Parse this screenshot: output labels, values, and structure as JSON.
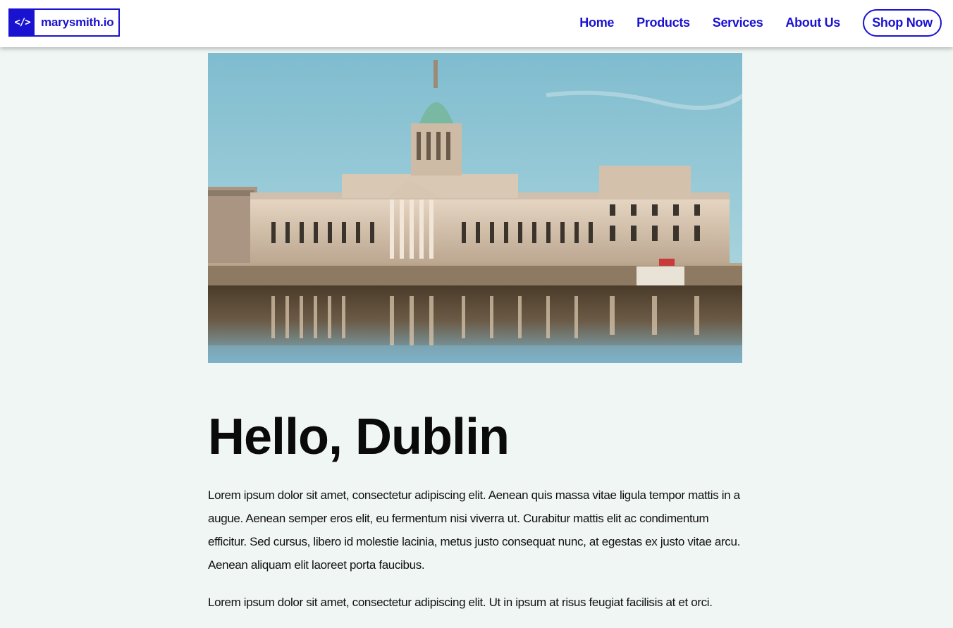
{
  "header": {
    "logo_mark": "</>",
    "logo_text": "marysmith.io",
    "nav": [
      "Home",
      "Products",
      "Services",
      "About Us"
    ],
    "cta_label": "Shop Now"
  },
  "colors": {
    "accent": "#1a12d1",
    "page_background": "#eff6f3",
    "header_background": "#ffffff",
    "heading_text": "#0a0a0a"
  },
  "hero": {
    "image_name": "dublin-custom-house-photo",
    "icon": "photo-icon"
  },
  "article": {
    "title": "Hello, Dublin",
    "paragraphs": [
      "Lorem ipsum dolor sit amet, consectetur adipiscing elit. Aenean quis massa vitae ligula tempor mattis in a augue. Aenean semper eros elit, eu fermentum nisi viverra ut. Curabitur mattis elit ac condimentum efficitur. Sed cursus, libero id molestie lacinia, metus justo consequat nunc, at egestas ex justo vitae arcu. Aenean aliquam elit laoreet porta faucibus.",
      "Lorem ipsum dolor sit amet, consectetur adipiscing elit. Ut in ipsum at risus feugiat facilisis at et orci."
    ]
  }
}
